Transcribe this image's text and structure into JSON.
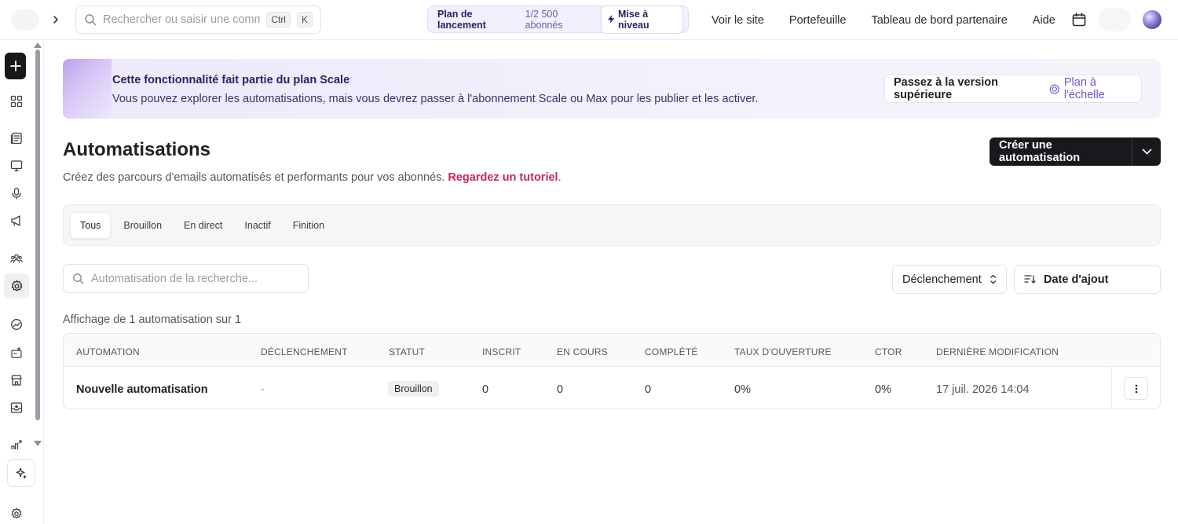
{
  "topbar": {
    "search_placeholder": "Rechercher ou saisir une comma...",
    "shortcut_ctrl": "Ctrl",
    "shortcut_key": "K",
    "plan_name": "Plan de lancement",
    "plan_count": "1/2 500 abonnés",
    "upgrade_label": "Mise à niveau",
    "nav": [
      "Voir le site",
      "Portefeuille",
      "Tableau de bord partenaire",
      "Aide"
    ]
  },
  "banner": {
    "title": "Cette fonctionnalité fait partie du plan Scale",
    "text": "Vous pouvez explorer les automatisations, mais vous devrez passer à l'abonnement Scale ou Max pour les publier et les activer.",
    "button_main": "Passez à la version supérieure",
    "button_plan": "Plan à l'échelle"
  },
  "page": {
    "title": "Automatisations",
    "subtitle": "Créez des parcours d'emails automatisés et performants pour vos abonnés.",
    "tutorial_link": "Regardez un tutoriel",
    "tutorial_suffix": ".",
    "create_button": "Créer une automatisation"
  },
  "tabs": [
    {
      "label": "Tous",
      "active": true
    },
    {
      "label": "Brouillon",
      "active": false
    },
    {
      "label": "En direct",
      "active": false
    },
    {
      "label": "Inactif",
      "active": false
    },
    {
      "label": "Finition",
      "active": false
    }
  ],
  "filters": {
    "search_placeholder": "Automatisation de la recherche...",
    "trigger_label": "Déclenchement",
    "sort_label": "Date d'ajout",
    "count_text": "Affichage de 1 automatisation sur 1"
  },
  "table": {
    "columns": [
      "AUTOMATION",
      "DÉCLENCHEMENT",
      "STATUT",
      "INSCRIT",
      "EN COURS",
      "COMPLÉTÉ",
      "TAUX D'OUVERTURE",
      "CTOR",
      "DERNIÈRE MODIFICATION"
    ],
    "rows": [
      {
        "name": "Nouvelle automatisation",
        "trigger": "-",
        "status": "Brouillon",
        "enrolled": "0",
        "in_progress": "0",
        "completed": "0",
        "open_rate": "0%",
        "ctor": "0%",
        "last_modified": "17 juil. 2026 14:04"
      }
    ]
  },
  "colors": {
    "accent_link": "#c42860",
    "plan_purple": "#6d53d6",
    "primary_button": "#18191c",
    "banner_bg": "#f3f1fb"
  }
}
